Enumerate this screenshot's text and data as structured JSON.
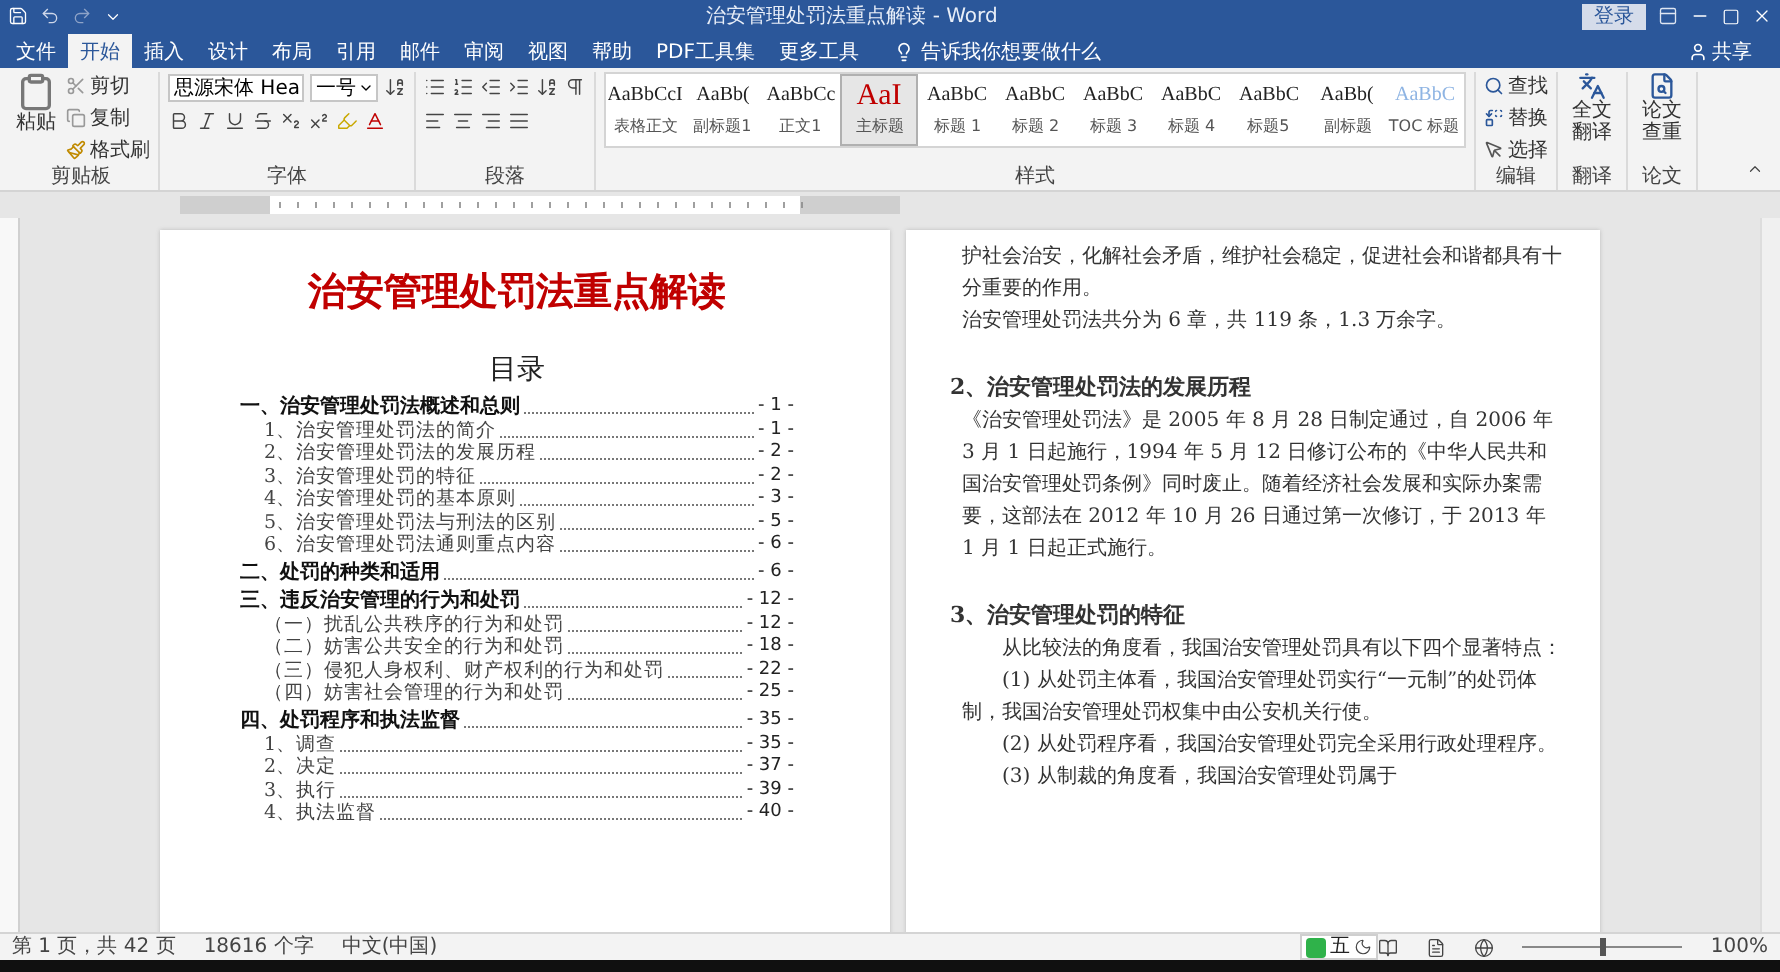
{
  "window": {
    "title": "治安管理处罚法重点解读 - Word",
    "login": "登录",
    "share": "共享"
  },
  "tabs": [
    {
      "label": "文件",
      "selected": false
    },
    {
      "label": "开始",
      "selected": true
    },
    {
      "label": "插入",
      "selected": false
    },
    {
      "label": "设计",
      "selected": false
    },
    {
      "label": "布局",
      "selected": false
    },
    {
      "label": "引用",
      "selected": false
    },
    {
      "label": "邮件",
      "selected": false
    },
    {
      "label": "审阅",
      "selected": false
    },
    {
      "label": "视图",
      "selected": false
    },
    {
      "label": "帮助",
      "selected": false
    },
    {
      "label": "PDF工具集",
      "selected": false
    },
    {
      "label": "更多工具",
      "selected": false
    }
  ],
  "tell_me": "告诉我你想要做什么",
  "ribbon": {
    "clipboard": {
      "paste": "粘贴",
      "cut": "剪切",
      "copy": "复制",
      "format_painter": "格式刷",
      "label": "剪贴板"
    },
    "font": {
      "name": "思源宋体 Hea",
      "size": "一号",
      "label": "字体"
    },
    "paragraph": {
      "label": "段落"
    },
    "styles": {
      "label": "样式",
      "items": [
        {
          "sample": "AaBbCcI",
          "name": "表格正文",
          "selected": false,
          "color": "#222222"
        },
        {
          "sample": "AaBb(",
          "name": "副标题1",
          "selected": false,
          "color": "#222222"
        },
        {
          "sample": "AaBbCc",
          "name": "正文1",
          "selected": false,
          "color": "#222222"
        },
        {
          "sample": "AaI",
          "name": "主标题",
          "selected": true,
          "color": "#c00000"
        },
        {
          "sample": "AaBbC",
          "name": "标题 1",
          "selected": false,
          "color": "#222222"
        },
        {
          "sample": "AaBbC",
          "name": "标题 2",
          "selected": false,
          "color": "#222222"
        },
        {
          "sample": "AaBbC",
          "name": "标题 3",
          "selected": false,
          "color": "#222222"
        },
        {
          "sample": "AaBbC",
          "name": "标题 4",
          "selected": false,
          "color": "#222222"
        },
        {
          "sample": "AaBbC",
          "name": "标题5",
          "selected": false,
          "color": "#222222"
        },
        {
          "sample": "AaBb(",
          "name": "副标题",
          "selected": false,
          "color": "#222222"
        },
        {
          "sample": "AaBbC",
          "name": "TOC 标题",
          "selected": false,
          "color": "#8eb4e3"
        }
      ]
    },
    "editing": {
      "find": "查找",
      "replace": "替换",
      "select": "选择",
      "label": "编辑"
    },
    "translate": {
      "button": "全文翻译",
      "label": "翻译"
    },
    "paper": {
      "button": "论文查重",
      "label": "论文"
    }
  },
  "left_page": {
    "title": "治安管理处罚法重点解读",
    "toc_heading": "目录",
    "toc": [
      {
        "text": "一、治安管理处罚法概述和总则",
        "page": "- 1 -",
        "children": [
          {
            "text": "1、治安管理处罚法的简介",
            "page": "- 1 -"
          },
          {
            "text": "2、治安管理处罚法的发展历程",
            "page": "- 2 -"
          },
          {
            "text": "3、治安管理处罚的特征",
            "page": "- 2 -"
          },
          {
            "text": "4、治安管理处罚的基本原则",
            "page": "- 3 -"
          },
          {
            "text": "5、治安管理处罚法与刑法的区别",
            "page": "- 5 -"
          },
          {
            "text": "6、治安管理处罚法通则重点内容",
            "page": "- 6 -"
          }
        ]
      },
      {
        "text": "二、处罚的种类和适用",
        "page": "- 6 -"
      },
      {
        "text": "三、违反治安管理的行为和处罚",
        "page": "- 12 -",
        "children": [
          {
            "text": "（一）扰乱公共秩序的行为和处罚",
            "page": "- 12 -"
          },
          {
            "text": "（二）妨害公共安全的行为和处罚",
            "page": "- 18 -"
          },
          {
            "text": "（三）侵犯人身权利、财产权利的行为和处罚",
            "page": "- 22 -"
          },
          {
            "text": "（四）妨害社会管理的行为和处罚",
            "page": "- 25 -"
          }
        ]
      },
      {
        "text": "四、处罚程序和执法监督",
        "page": "- 35 -",
        "children": [
          {
            "text": "1、调查",
            "page": "- 35 -"
          },
          {
            "text": "2、决定",
            "page": "- 37 -"
          },
          {
            "text": "3、执行",
            "page": "- 39 -"
          },
          {
            "text": "4、执法监督",
            "page": "- 40 -"
          }
        ]
      }
    ]
  },
  "right_page": {
    "paragraphs": [
      {
        "kind": "body",
        "text": "护社会治安，化解社会矛盾，维护社会稳定，促进社会和谐都具有十分重要的作用。"
      },
      {
        "kind": "body",
        "text": "治安管理处罚法共分为 6 章，共 119 条，1.3 万余字。"
      },
      {
        "kind": "blank"
      },
      {
        "kind": "heading",
        "text": "2、治安管理处罚法的发展历程"
      },
      {
        "kind": "body",
        "text": "《治安管理处罚法》是 2005 年 8 月 28 日制定通过，自 2006 年 3 月 1 日起施行，1994 年 5 月 12 日修订公布的《中华人民共和国治安管理处罚条例》同时废止。随着经济社会发展和实际办案需要，这部法在 2012 年 10 月 26 日通过第一次修订，于 2013 年 1 月 1 日起正式施行。"
      },
      {
        "kind": "blank"
      },
      {
        "kind": "heading",
        "text": "3、治安管理处罚的特征"
      },
      {
        "kind": "indent",
        "text": "从比较法的角度看，我国治安管理处罚具有以下四个显著特点："
      },
      {
        "kind": "indent",
        "text": "(1) 从处罚主体看，我国治安管理处罚实行“一元制”的处罚体制，我国治安管理处罚权集中由公安机关行使。"
      },
      {
        "kind": "indent",
        "text": "(2) 从处罚程序看，我国治安管理处罚完全采用行政处理程序。"
      },
      {
        "kind": "indent",
        "text": "(3) 从制裁的角度看，我国治安管理处罚属于"
      }
    ]
  },
  "ime": {
    "label": "五"
  },
  "status_bar": {
    "page": "第 1 页，共 42 页",
    "words": "18616 个字",
    "language": "中文(中国)",
    "zoom": "100%",
    "level": 0.5
  }
}
